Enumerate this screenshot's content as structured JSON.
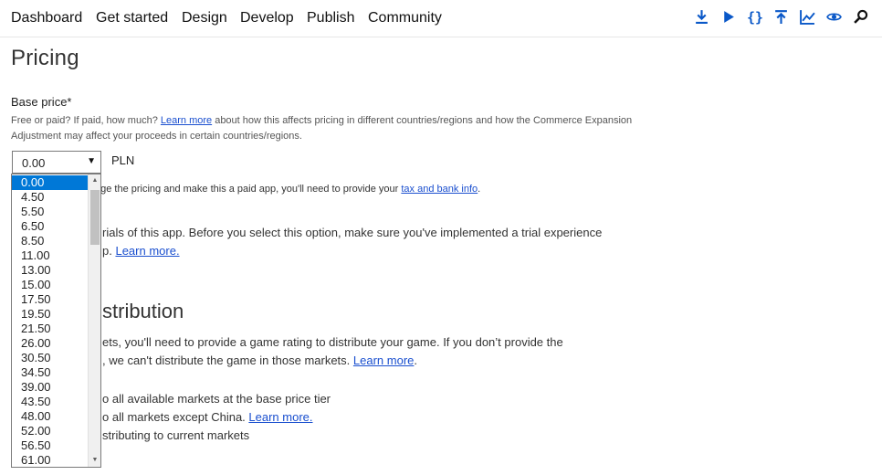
{
  "nav": {
    "items": [
      "Dashboard",
      "Get started",
      "Design",
      "Develop",
      "Publish",
      "Community"
    ]
  },
  "tools": [
    "download-icon",
    "play-icon",
    "code-braces-icon",
    "upload-icon",
    "chart-icon",
    "eye-icon",
    "search-icon"
  ],
  "page": {
    "title": "Pricing"
  },
  "base_price": {
    "label": "Base price*",
    "help_pre": "Free or paid? If paid, how much? ",
    "help_link": "Learn more",
    "help_post": " about how this affects pricing in different countries/regions and how the Commerce Expansion Adjustment may affect your proceeds in certain countries/regions.",
    "selected": "0.00",
    "currency": "PLN"
  },
  "dropdown": {
    "options": [
      "0.00",
      "4.50",
      "5.50",
      "6.50",
      "8.50",
      "11.00",
      "13.00",
      "15.00",
      "17.50",
      "19.50",
      "21.50",
      "26.00",
      "30.50",
      "34.50",
      "39.00",
      "43.50",
      "48.00",
      "52.00",
      "56.50",
      "61.00"
    ],
    "selected_index": 0
  },
  "obscured": {
    "paid_note_pre": "nge the pricing and make this a paid app, you'll need to provide your ",
    "paid_note_link": "tax and bank info",
    "paid_note_post": ".",
    "trial_text": "rials of this app. Before you select this option, make sure you've implemented a trial experience",
    "trial_line2_pre": "p. ",
    "trial_link": "Learn more.",
    "dist_heading": "stribution",
    "dist_text1": "ets, you'll need to provide a game rating to distribute your game. If you don’t provide the",
    "dist_text2_pre": ", we can't distribute the game in those markets. ",
    "dist_link": "Learn more",
    "dist_text2_post": ".",
    "opt_all_markets": "o all available markets at the base price tier",
    "opt_except_china_pre": "o all markets except China. ",
    "opt_except_china_link": "Learn more.",
    "opt_stop": "stributing to current markets"
  }
}
